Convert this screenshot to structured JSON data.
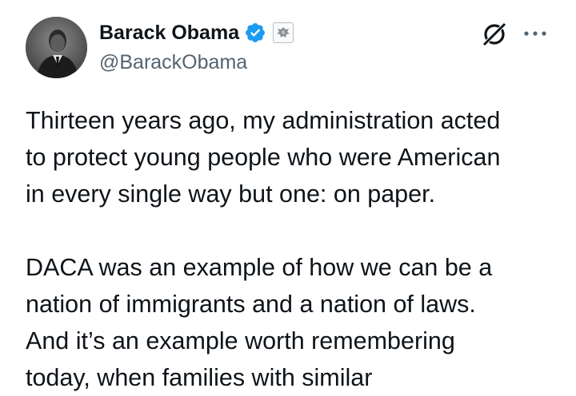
{
  "author": {
    "display_name": "Barack Obama",
    "handle": "@BarackObama",
    "verified_icon": "verified-badge-icon",
    "affiliation_icon": "government-seal-icon",
    "verified_color": "#1d9bf0"
  },
  "actions": {
    "grok_icon": "grok-icon",
    "more_icon": "more-options-icon"
  },
  "tweet": {
    "paragraph1": [
      "Thirteen years ago, my administration acted",
      "to protect young people who were American",
      "in every single way but one: on paper."
    ],
    "paragraph2": [
      "DACA was an example of how we can be a",
      "nation of immigrants and a nation of laws.",
      "And it’s an example worth remembering",
      "today, when families with similar"
    ]
  }
}
